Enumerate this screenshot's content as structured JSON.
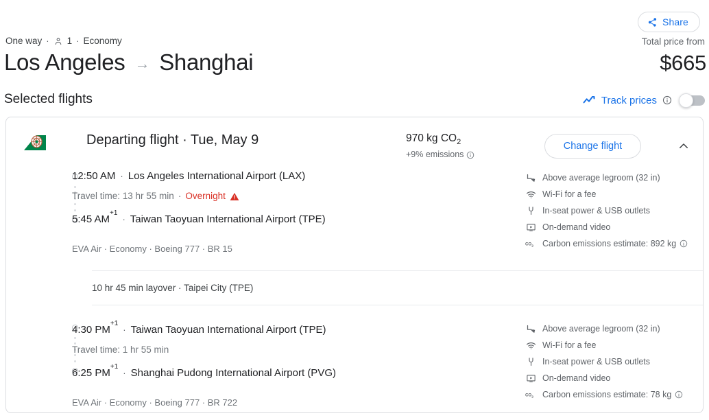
{
  "header": {
    "share_label": "Share",
    "share_icon": "share-icon",
    "trip_type": "One way",
    "passenger_icon": "person-icon",
    "passenger_count": "1",
    "cabin_class": "Economy",
    "separator": "·",
    "origin": "Los Angeles",
    "arrow": "→",
    "destination": "Shanghai",
    "price_label": "Total price from",
    "price_value": "$665"
  },
  "selected": {
    "title": "Selected flights",
    "track_prices_label": "Track prices",
    "track_icon": "trending-up-icon",
    "info_icon": "info-icon",
    "toggle_state": "off"
  },
  "card": {
    "airline_logo": "eva-air-tail-logo",
    "head_title": "Departing flight · Tue, May 9",
    "co2_amount": "970 kg CO",
    "co2_subscript": "2",
    "co2_delta": "+9% emissions",
    "change_flight_label": "Change flight",
    "collapse_icon": "chevron-up-icon",
    "layover": "10 hr 45 min layover · Taipei City (TPE)",
    "segments": [
      {
        "depart_time": "12:50 AM",
        "depart_sup": "",
        "depart_airport": "Los Angeles International Airport (LAX)",
        "travel_time": "Travel time: 13 hr 55 min",
        "overnight_sep": "·",
        "overnight_label": "Overnight",
        "warning_icon": "warning-triangle-icon",
        "arrive_time": "5:45 AM",
        "arrive_sup": "+1",
        "arrive_airport": "Taiwan Taoyuan International Airport (TPE)",
        "operator_info": "EVA Air · Economy · Boeing 777 · BR 15",
        "amenities": [
          {
            "icon": "legroom-icon",
            "label": "Above average legroom (32 in)",
            "has_info": false
          },
          {
            "icon": "wifi-icon",
            "label": "Wi-Fi for a fee",
            "has_info": false
          },
          {
            "icon": "power-plug-icon",
            "label": "In-seat power & USB outlets",
            "has_info": false
          },
          {
            "icon": "video-icon",
            "label": "On-demand video",
            "has_info": false
          },
          {
            "icon": "co2-icon",
            "label": "Carbon emissions estimate: 892 kg",
            "has_info": true
          }
        ]
      },
      {
        "depart_time": "4:30 PM",
        "depart_sup": "+1",
        "depart_airport": "Taiwan Taoyuan International Airport (TPE)",
        "travel_time": "Travel time: 1 hr 55 min",
        "overnight_sep": "",
        "overnight_label": "",
        "warning_icon": "",
        "arrive_time": "6:25 PM",
        "arrive_sup": "+1",
        "arrive_airport": "Shanghai Pudong International Airport (PVG)",
        "operator_info": "EVA Air · Economy · Boeing 777 · BR 722",
        "amenities": [
          {
            "icon": "legroom-icon",
            "label": "Above average legroom (32 in)",
            "has_info": false
          },
          {
            "icon": "wifi-icon",
            "label": "Wi-Fi for a fee",
            "has_info": false
          },
          {
            "icon": "power-plug-icon",
            "label": "In-seat power & USB outlets",
            "has_info": false
          },
          {
            "icon": "video-icon",
            "label": "On-demand video",
            "has_info": false
          },
          {
            "icon": "co2-icon",
            "label": "Carbon emissions estimate: 78 kg",
            "has_info": true
          }
        ]
      }
    ]
  },
  "colors": {
    "accent_blue": "#1a73e8",
    "text_primary": "#202124",
    "text_secondary": "#5f6368",
    "warning_red": "#d93025",
    "border": "#dadce0",
    "eva_green": "#00855a"
  }
}
